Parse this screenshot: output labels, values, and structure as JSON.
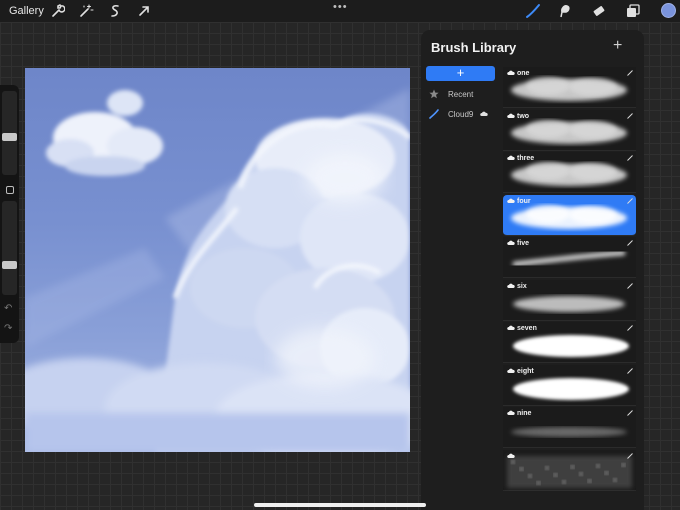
{
  "topbar": {
    "gallery_label": "Gallery",
    "more_label": "•••",
    "tools_left": [
      "wrench-icon",
      "magic-wand-icon",
      "selection-icon",
      "transform-arrow-icon"
    ],
    "tools_right": [
      "brush-icon",
      "smudge-icon",
      "eraser-icon",
      "layers-icon"
    ],
    "active_tool": "brush-icon",
    "current_color": "#7a93dc"
  },
  "sidebar": {
    "size_slider_level": 0.45,
    "opacity_slider_level": 0.3,
    "undo_icon": "undo-icon",
    "redo_icon": "redo-icon"
  },
  "canvas": {
    "content": "cloud painting"
  },
  "brush_library": {
    "title": "Brush Library",
    "add_set_label": "+",
    "sets": [
      {
        "label": "Recent",
        "icon": "star-icon"
      },
      {
        "label": "Cloud9",
        "icon": "brush-stroke-icon"
      }
    ],
    "brushes": [
      {
        "name": "one",
        "selected": false,
        "style": "puff"
      },
      {
        "name": "two",
        "selected": false,
        "style": "puff"
      },
      {
        "name": "three",
        "selected": false,
        "style": "puff"
      },
      {
        "name": "four",
        "selected": true,
        "style": "puff"
      },
      {
        "name": "five",
        "selected": false,
        "style": "line"
      },
      {
        "name": "six",
        "selected": false,
        "style": "soft"
      },
      {
        "name": "seven",
        "selected": false,
        "style": "solid"
      },
      {
        "name": "eight",
        "selected": false,
        "style": "solid"
      },
      {
        "name": "nine",
        "selected": false,
        "style": "wisp"
      },
      {
        "name": "",
        "selected": false,
        "style": "sparkle"
      }
    ],
    "accent": "#2f7bf5"
  }
}
